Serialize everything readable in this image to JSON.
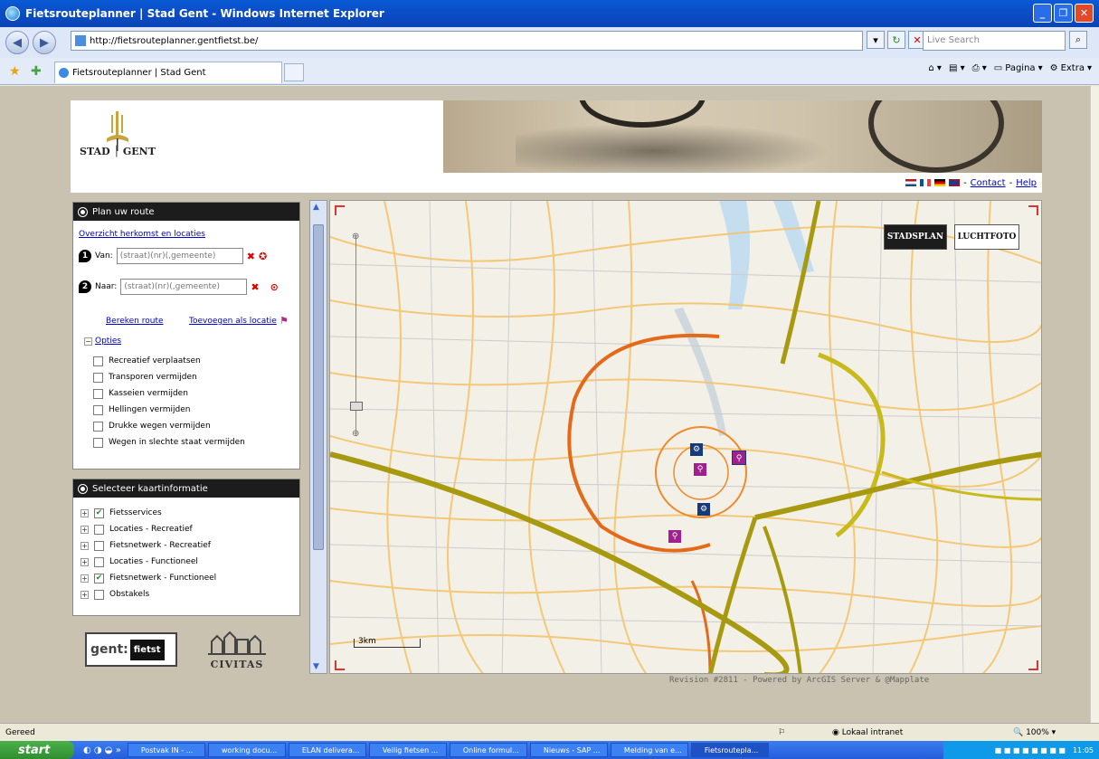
{
  "window": {
    "title": "Fietsrouteplanner | Stad Gent - Windows Internet Explorer"
  },
  "browser": {
    "url": "http://fietsrouteplanner.gentfietst.be/",
    "search_placeholder": "Live Search",
    "tab_title": "Fietsrouteplanner | Stad Gent",
    "cmd_page": "Pagina",
    "cmd_extra": "Extra"
  },
  "header": {
    "logo_left": "STAD",
    "logo_right": "GENT",
    "contact": "Contact",
    "help": "Help",
    "sep1": "-",
    "sep2": "-"
  },
  "route_panel": {
    "title": "Plan uw route",
    "overview_link": "Overzicht herkomst en locaties",
    "from_label": "Van:",
    "from_placeholder": "(straat)(nr)(,gemeente)",
    "to_label": "Naar:",
    "to_placeholder": "(straat)(nr)(,gemeente)",
    "calc_link": "Bereken route",
    "add_link": "Toevoegen als locatie",
    "options_label": "Opties",
    "options": [
      "Recreatief verplaatsen",
      "Transporen vermijden",
      "Kasseien vermijden",
      "Hellingen vermijden",
      "Drukke wegen vermijden",
      "Wegen in slechte staat vermijden"
    ]
  },
  "layers_panel": {
    "title": "Selecteer kaartinformatie",
    "layers": [
      {
        "label": "Fietsservices",
        "checked": true
      },
      {
        "label": "Locaties - Recreatief",
        "checked": false
      },
      {
        "label": "Fietsnetwerk - Recreatief",
        "checked": false
      },
      {
        "label": "Locaties - Functioneel",
        "checked": false
      },
      {
        "label": "Fietsnetwerk - Functioneel",
        "checked": true
      },
      {
        "label": "Obstakels",
        "checked": false
      }
    ]
  },
  "logos": {
    "gent_fietst_1": "gent:",
    "gent_fietst_2": "fietst",
    "civitas": "CIVITAS"
  },
  "map": {
    "stadsplan": "STADSPLAN",
    "luchtfoto": "LUCHTFOTO",
    "scale": "3km",
    "revision": "Revision #2811 - Powered by ArcGIS Server & @Mapplate"
  },
  "status": {
    "left": "Gereed",
    "zone": "Lokaal intranet",
    "zoom": "100%"
  },
  "taskbar": {
    "start": "start",
    "tasks": [
      "Postvak IN - ...",
      "working docu...",
      "ELAN delivera...",
      "Veilig fietsen ...",
      "Online formul...",
      "Nieuws - SAP ...",
      "Melding van e...",
      "Fietsroutepla..."
    ],
    "clock": "11:05"
  }
}
